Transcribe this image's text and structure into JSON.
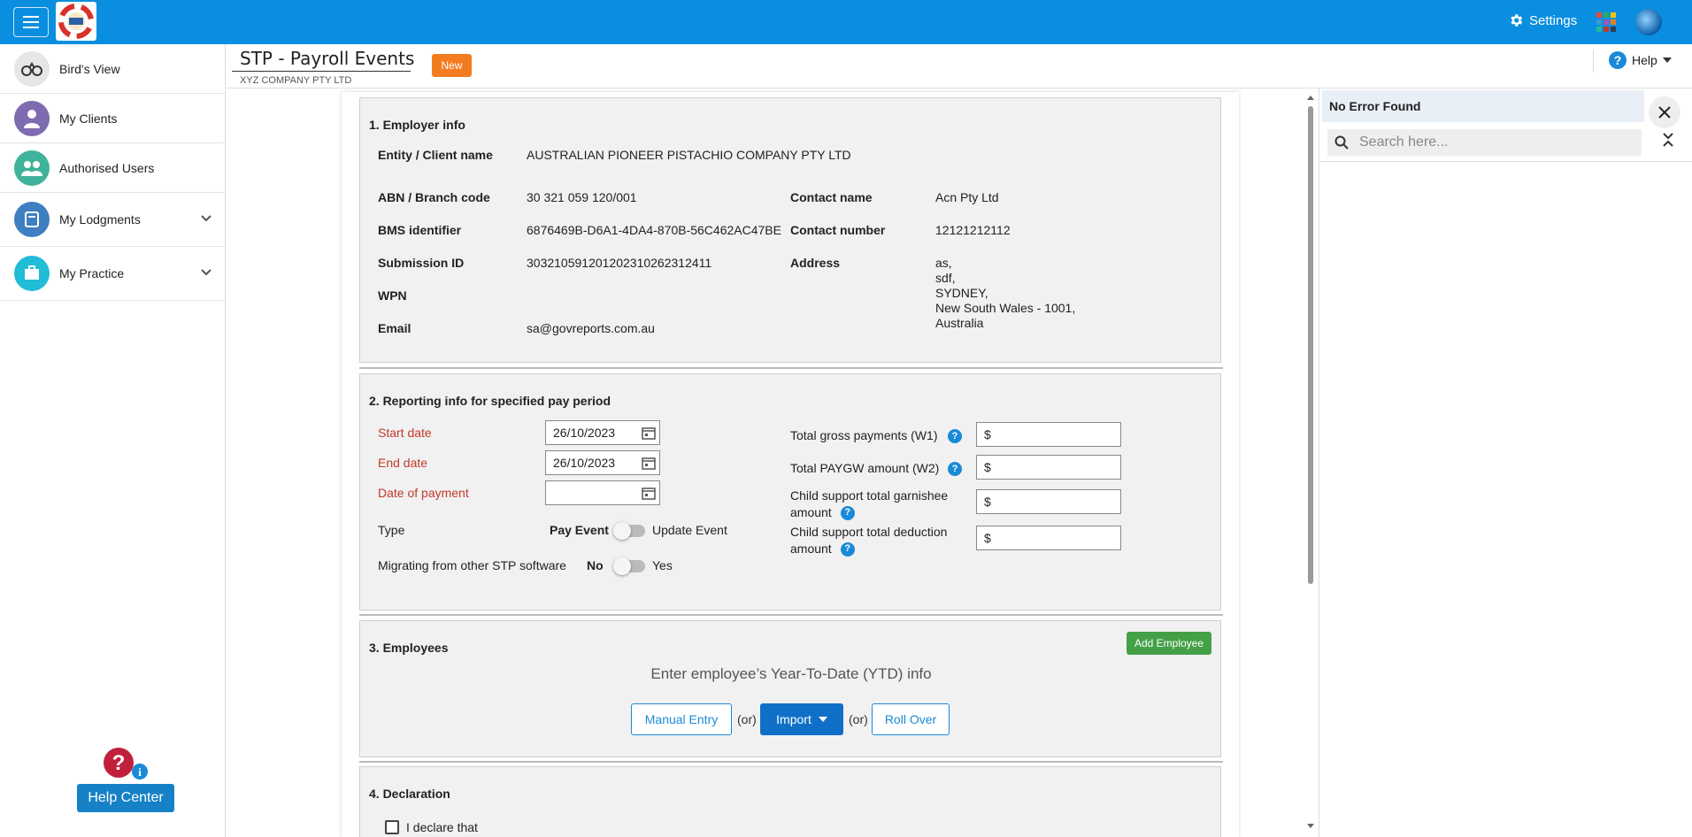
{
  "topbar": {
    "settings_label": "Settings",
    "icons": [
      "menu-icon",
      "app-logo",
      "gear-icon",
      "apps-grid-icon",
      "globe-icon"
    ]
  },
  "sidebar": {
    "items": [
      {
        "label": "Bird's View",
        "icon": "binoculars-icon",
        "color": "#e0e0e0"
      },
      {
        "label": "My Clients",
        "icon": "person-icon",
        "color": "#7e6bb0"
      },
      {
        "label": "Authorised Users",
        "icon": "users-icon",
        "color": "#3fb29a"
      },
      {
        "label": "My Lodgments",
        "icon": "book-icon",
        "color": "#3f7ec0"
      },
      {
        "label": "My Practice",
        "icon": "briefcase-icon",
        "color": "#20bcd8"
      }
    ],
    "help_center_label": "Help Center"
  },
  "header": {
    "title": "STP - Payroll Events",
    "subtitle": "XYZ COMPANY PTY LTD",
    "badge": "New",
    "help_label": "Help"
  },
  "employer_info": {
    "section_title": "1. Employer info",
    "entity_label": "Entity / Client name",
    "entity_value": "AUSTRALIAN PIONEER PISTACHIO COMPANY PTY LTD",
    "abn_label": "ABN / Branch code",
    "abn_value": "30 321 059 120/001",
    "bms_label": "BMS identifier",
    "bms_value": "6876469B-D6A1-4DA4-870B-56C462AC47BE",
    "submission_label": "Submission ID",
    "submission_value": "30321059120120231026231241​1",
    "wpn_label": "WPN",
    "wpn_value": "",
    "email_label": "Email",
    "email_value": "sa@govreports.com.au",
    "contact_name_label": "Contact name",
    "contact_name_value": "Acn Pty Ltd",
    "contact_number_label": "Contact number",
    "contact_number_value": "12121212112",
    "address_label": "Address",
    "address_lines": [
      "as,",
      "sdf,",
      "SYDNEY,",
      "New South Wales - 1001,",
      "Australia"
    ]
  },
  "reporting": {
    "section_title": "2. Reporting info for specified pay period",
    "start_date_label": "Start date",
    "start_date_value": "26/10/2023",
    "end_date_label": "End date",
    "end_date_value": "26/10/2023",
    "payment_date_label": "Date of payment",
    "payment_date_value": "",
    "type_label": "Type",
    "type_option_a": "Pay Event",
    "type_option_b": "Update Event",
    "migrating_label": "Migrating from other STP software",
    "migrating_option_a": "No",
    "migrating_option_b": "Yes",
    "w1_label": "Total gross payments (W1)",
    "w2_label": "Total PAYGW amount (W2)",
    "garnishee_label_1": "Child support total garnishee",
    "garnishee_label_2": "amount",
    "deduction_label_1": "Child support total deduction",
    "deduction_label_2": "amount",
    "currency_symbol": "$"
  },
  "employees": {
    "section_title": "3. Employees",
    "add_button": "Add Employee",
    "ytd_text": "Enter employee’s Year-To-Date (YTD) info",
    "manual_entry": "Manual Entry",
    "or_text": "(or)",
    "import_label": "Import",
    "roll_over": "Roll Over"
  },
  "declaration": {
    "section_title": "4. Declaration",
    "checkbox_label": "I declare that"
  },
  "right_panel": {
    "status": "No Error Found",
    "search_placeholder": "Search here..."
  }
}
